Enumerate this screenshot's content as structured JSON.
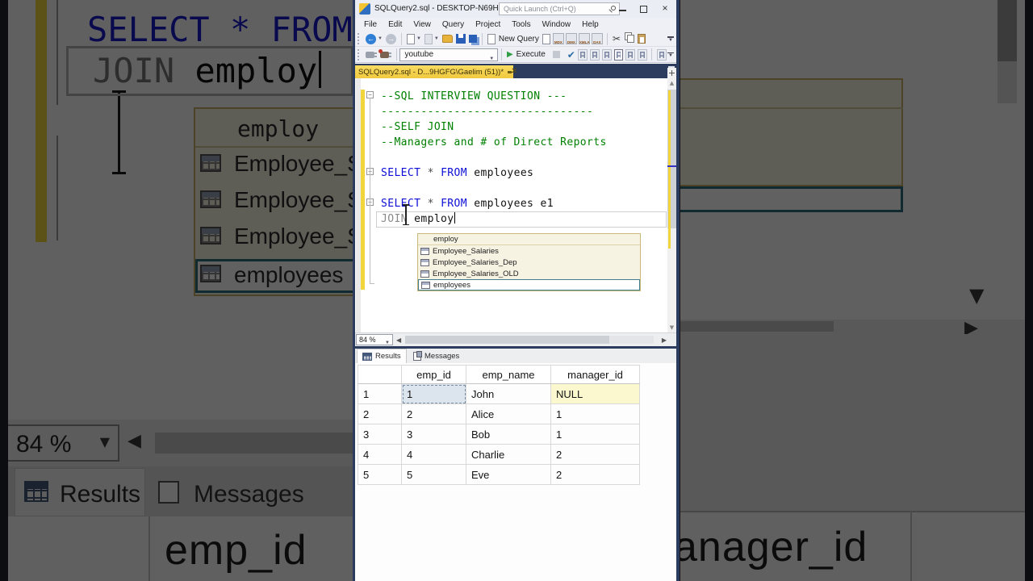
{
  "window": {
    "title": "SQLQuery2.sql - DESKTOP-N69HGF...",
    "quick_launch_placeholder": "Quick Launch (Ctrl+Q)"
  },
  "menu": {
    "items": [
      "File",
      "Edit",
      "View",
      "Query",
      "Project",
      "Tools",
      "Window",
      "Help"
    ]
  },
  "toolbar": {
    "new_query_label": "New Query",
    "query_type_labels": [
      "MDX",
      "DMX",
      "XMLA",
      "DAX"
    ],
    "database_selector_value": "youtube",
    "execute_label": "Execute"
  },
  "tab": {
    "label": "SQLQuery2.sql - D...9HGFG\\Gaelim (51))*"
  },
  "editor": {
    "zoom_level": "84 %",
    "lines": [
      {
        "segments": [
          {
            "text": "--SQL INTERVIEW QUESTION ---",
            "type": "comment"
          }
        ]
      },
      {
        "segments": [
          {
            "text": "--------------------------------",
            "type": "comment"
          }
        ]
      },
      {
        "segments": [
          {
            "text": "--SELF JOIN",
            "type": "comment"
          }
        ]
      },
      {
        "segments": [
          {
            "text": "--Managers and # of Direct Reports",
            "type": "comment"
          }
        ]
      },
      {
        "segments": []
      },
      {
        "segments": [
          {
            "text": "SELECT",
            "type": "keyword"
          },
          {
            "text": " ",
            "type": "plain"
          },
          {
            "text": "*",
            "type": "operator"
          },
          {
            "text": " ",
            "type": "plain"
          },
          {
            "text": "FROM",
            "type": "keyword"
          },
          {
            "text": " employees",
            "type": "plain"
          }
        ]
      },
      {
        "segments": []
      },
      {
        "segments": [
          {
            "text": "SELECT",
            "type": "keyword"
          },
          {
            "text": " ",
            "type": "plain"
          },
          {
            "text": "*",
            "type": "operator"
          },
          {
            "text": " ",
            "type": "plain"
          },
          {
            "text": "FROM",
            "type": "keyword"
          },
          {
            "text": " employees e1",
            "type": "plain"
          }
        ]
      },
      {
        "segments": [
          {
            "text": "JOIN",
            "type": "keyword-gray"
          },
          {
            "text": " employ",
            "type": "plain"
          }
        ],
        "caret": true
      }
    ]
  },
  "intellisense": {
    "items": [
      {
        "label": "employ",
        "icon": "none",
        "selected": false
      },
      {
        "label": "Employee_Salaries",
        "icon": "table-icon",
        "selected": false
      },
      {
        "label": "Employee_Salaries_Dep",
        "icon": "table-icon",
        "selected": false
      },
      {
        "label": "Employee_Salaries_OLD",
        "icon": "table-icon",
        "selected": false
      },
      {
        "label": "employees",
        "icon": "table-icon",
        "selected": true
      }
    ]
  },
  "results_pane": {
    "tabs": [
      {
        "label": "Results"
      },
      {
        "label": "Messages"
      }
    ]
  },
  "grid": {
    "columns": [
      "emp_id",
      "emp_name",
      "manager_id"
    ],
    "rows": [
      {
        "num": "1",
        "cells": [
          "1",
          "John",
          "NULL"
        ]
      },
      {
        "num": "2",
        "cells": [
          "2",
          "Alice",
          "1"
        ]
      },
      {
        "num": "3",
        "cells": [
          "3",
          "Bob",
          "1"
        ]
      },
      {
        "num": "4",
        "cells": [
          "4",
          "Charlie",
          "2"
        ]
      },
      {
        "num": "5",
        "cells": [
          "5",
          "Eve",
          "2"
        ]
      }
    ],
    "selected_cell": {
      "row": 0,
      "col": 0
    }
  },
  "background": {
    "code_line_1": "SELECT * FROM",
    "code_line_2": "JOIN employ",
    "list_items": [
      "employ",
      "Employee_S",
      "Employee_S",
      "Employee_S",
      "employees"
    ],
    "zoom_level": "84 %",
    "results_tab": "Results",
    "messages_tab": "Messages",
    "grid_header_left": "emp_id",
    "grid_header_right": "anager_id"
  },
  "colors": {
    "tab_gold": "#f0c93e",
    "keyword_blue": "#0d0dd6",
    "comment_green": "#008000",
    "tabbar_navy": "#2c3c5f",
    "change_track_yellow": "#f2d53c"
  }
}
